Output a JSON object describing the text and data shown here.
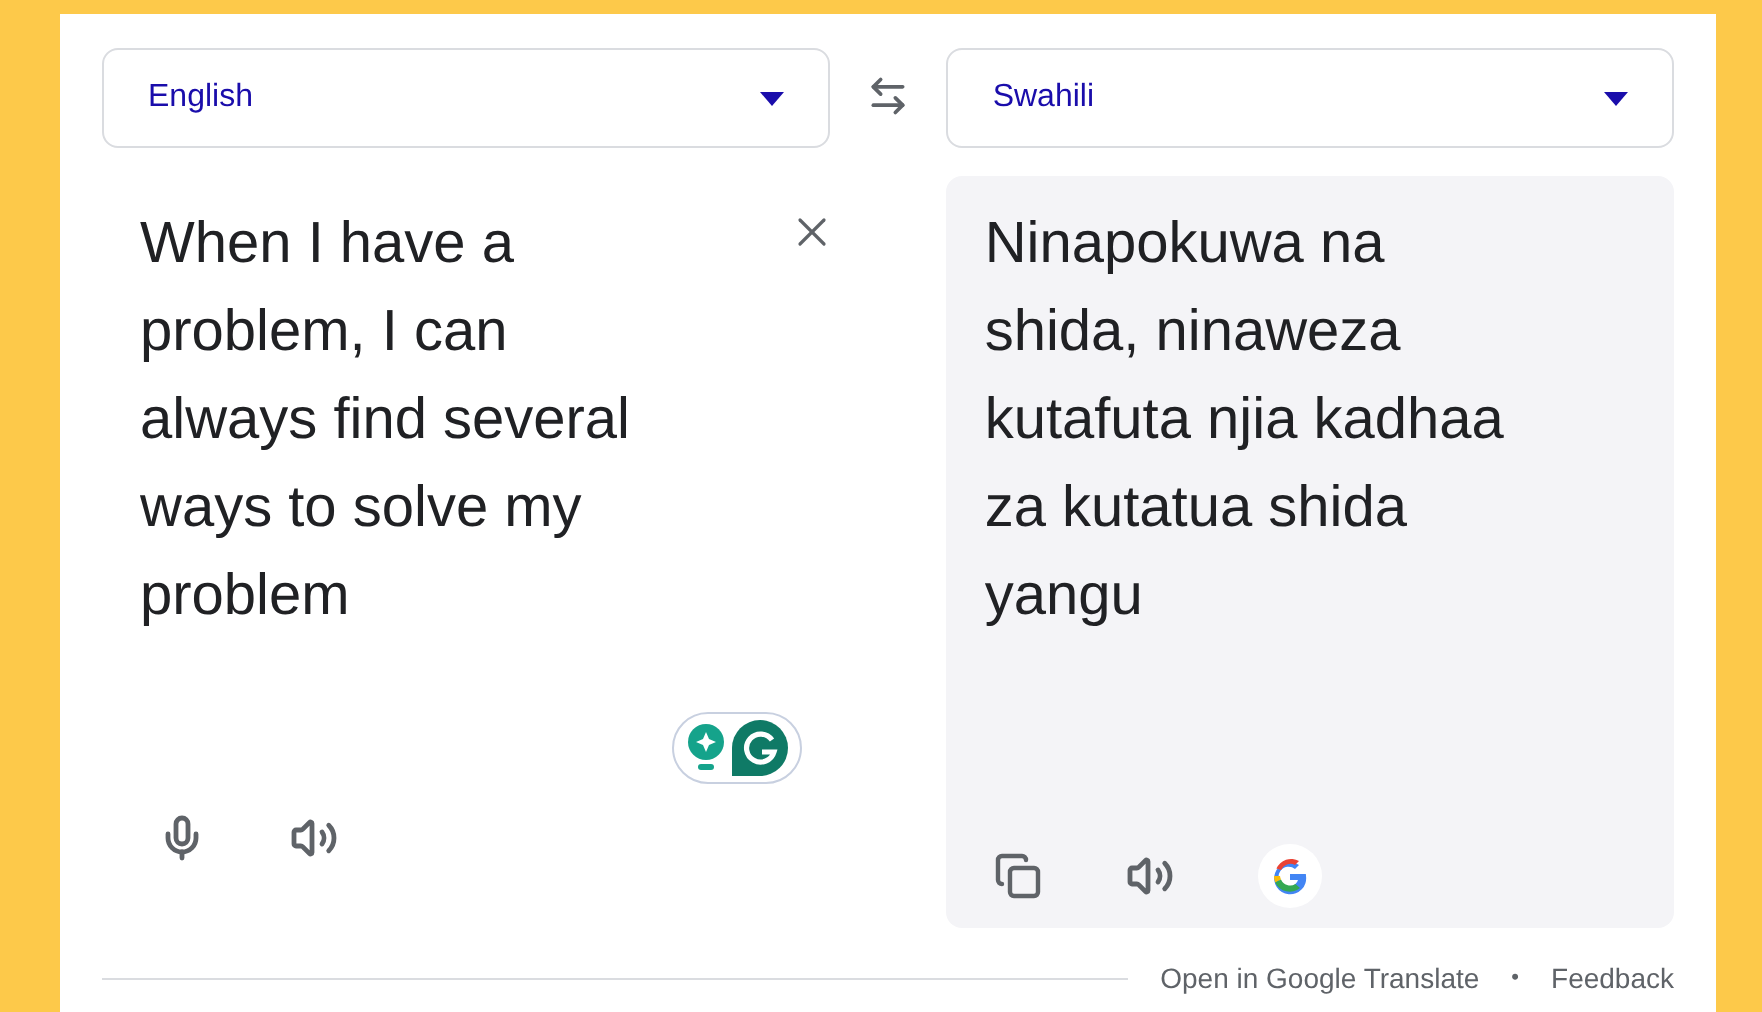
{
  "source": {
    "language": "English",
    "lines": [
      "When I have a",
      "problem, I can",
      "always find several",
      "ways to solve my",
      "problem"
    ]
  },
  "target": {
    "language": "Swahili",
    "lines": [
      "Ninapokuwa na",
      "shida, ninaweza",
      "kutafuta njia kadhaa",
      "za kutatua shida",
      "yangu"
    ]
  },
  "footer": {
    "link": "Open in Google Translate",
    "separator": "•",
    "feedback": "Feedback"
  }
}
